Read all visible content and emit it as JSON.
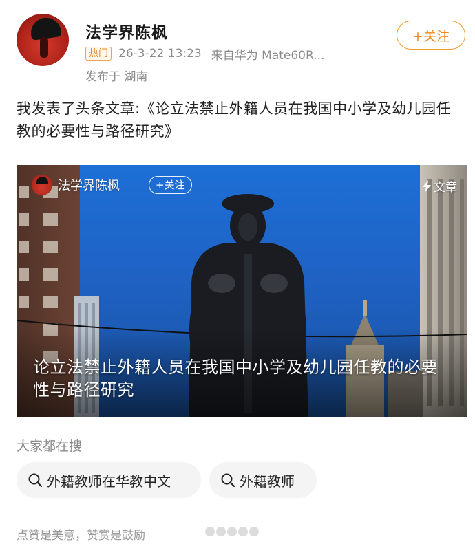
{
  "post": {
    "author": "法学界陈枫",
    "hot_badge": "热门",
    "time": "26-3-22 13:23",
    "source": "来自华为 Mate60R...",
    "location": "发布于 湖南",
    "follow_label": "+关注",
    "text": "我发表了头条文章:《论立法禁止外籍人员在我国中小学及幼儿园任教的必要性与路径研究》"
  },
  "article_card": {
    "author": "法学界陈枫",
    "follow_label": "+关注",
    "type_label": "文章",
    "title": "论立法禁止外籍人员在我国中小学及幼儿园任教的必要性与路径研究",
    "sky_color": "#1f62c4"
  },
  "search": {
    "heading": "大家都在搜",
    "suggestions": [
      {
        "label": "外籍教师在华教中文",
        "icon": "search-icon"
      },
      {
        "label": "外籍教师",
        "icon": "search-icon"
      }
    ]
  },
  "footer": {
    "text": "点赞是美意，赞赏是鼓励"
  },
  "colors": {
    "accent": "#f08a1c",
    "badge": "#e8872a",
    "meta": "#8c8c8c"
  }
}
